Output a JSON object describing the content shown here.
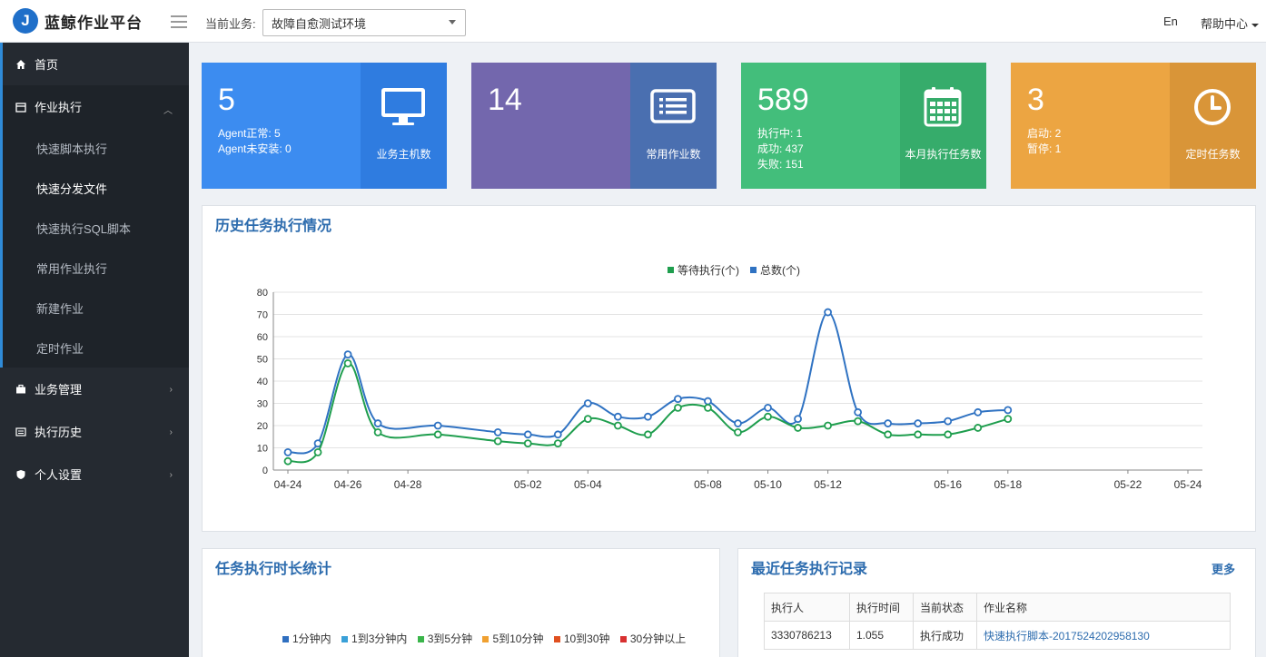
{
  "app": {
    "logo_letter": "J",
    "title": "蓝鲸作业平台"
  },
  "header": {
    "business_label": "当前业务:",
    "business_value": "故障自愈测试环境",
    "lang": "En",
    "help": "帮助中心"
  },
  "sidebar": {
    "home": "首页",
    "job_exec": "作业执行",
    "sub_items": [
      "快速脚本执行",
      "快速分发文件",
      "快速执行SQL脚本",
      "常用作业执行",
      "新建作业",
      "定时作业"
    ],
    "biz_manage": "业务管理",
    "exec_history": "执行历史",
    "personal": "个人设置"
  },
  "cards": [
    {
      "num": "5",
      "lines": [
        "Agent正常: 5",
        "Agent未安装: 0"
      ],
      "caption": "业务主机数",
      "color_left": "#3c8cf0",
      "color_right": "#2f7ce0",
      "icon": "monitor-icon"
    },
    {
      "num": "14",
      "lines": [],
      "caption": "常用作业数",
      "color_left": "#7367ad",
      "color_right": "#4a6fb0",
      "icon": "list-card-icon"
    },
    {
      "num": "589",
      "lines": [
        "执行中: 1",
        "成功: 437",
        "失败: 151"
      ],
      "caption": "本月执行任务数",
      "color_left": "#43be7b",
      "color_right": "#36ac6b",
      "icon": "calendar-icon"
    },
    {
      "num": "3",
      "lines": [
        "启动: 2",
        "暂停: 1"
      ],
      "caption": "定时任务数",
      "color_left": "#eca542",
      "color_right": "#d99538",
      "icon": "clock-icon"
    }
  ],
  "history_panel": {
    "title": "历史任务执行情况"
  },
  "duration_panel": {
    "title": "任务执行时长统计",
    "legend": [
      {
        "label": "1分钟内",
        "color": "#2f6fc0"
      },
      {
        "label": "1到3分钟内",
        "color": "#3aa0d8"
      },
      {
        "label": "3到5分钟",
        "color": "#3ab54a"
      },
      {
        "label": "5到10分钟",
        "color": "#f0a030"
      },
      {
        "label": "10到30钟",
        "color": "#e05020"
      },
      {
        "label": "30分钟以上",
        "color": "#d83030"
      }
    ]
  },
  "records_panel": {
    "title": "最近任务执行记录",
    "more": "更多",
    "headers": [
      "执行人",
      "执行时间",
      "当前状态",
      "作业名称"
    ],
    "rows": [
      [
        "3330786213",
        "1.055",
        "执行成功",
        "快速执行脚本-2017524202958130"
      ]
    ]
  },
  "chart_data": {
    "type": "line",
    "title": "",
    "xlabel": "",
    "ylabel": "",
    "ylim": [
      0,
      80
    ],
    "yticks": [
      0,
      10,
      20,
      30,
      40,
      50,
      60,
      70,
      80
    ],
    "x": [
      "04-24",
      "04-25",
      "04-26",
      "04-27",
      "04-28",
      "04-29",
      "04-30",
      "05-01",
      "05-02",
      "05-03",
      "05-04",
      "05-05",
      "05-06",
      "05-07",
      "05-08",
      "05-09",
      "05-10",
      "05-11",
      "05-12",
      "05-13",
      "05-14",
      "05-15",
      "05-16",
      "05-17",
      "05-18",
      "05-19",
      "05-20",
      "05-21",
      "05-22",
      "05-23",
      "05-24"
    ],
    "xtick_labels": [
      "04-24",
      "04-26",
      "04-28",
      "05-02",
      "05-04",
      "05-08",
      "05-10",
      "05-12",
      "05-16",
      "05-18",
      "05-22",
      "05-24"
    ],
    "point_x": [
      "04-24",
      "04-25",
      "04-26",
      "04-27",
      "04-28",
      "04-29",
      "05-01",
      "05-03",
      "05-04",
      "05-05",
      "05-06",
      "05-07",
      "05-08",
      "05-09",
      "05-10",
      "05-12",
      "05-13",
      "05-14",
      "05-15",
      "05-16",
      "05-17",
      "05-18",
      "05-19",
      "05-20",
      "05-21",
      "05-22",
      "05-23",
      "05-24"
    ],
    "legend_position": "top",
    "series": [
      {
        "name": "等待执行(个)",
        "color": "#1f9e4e",
        "values": [
          4,
          8,
          48,
          17,
          16,
          13,
          12,
          12,
          23,
          20,
          16,
          28,
          28,
          17,
          24,
          19,
          20,
          22,
          16,
          16,
          16,
          19,
          23
        ]
      },
      {
        "name": "总数(个)",
        "color": "#2f72c2",
        "values": [
          8,
          12,
          52,
          21,
          20,
          17,
          16,
          16,
          30,
          24,
          24,
          32,
          31,
          21,
          28,
          23,
          71,
          26,
          21,
          21,
          22,
          26,
          27
        ]
      }
    ],
    "point_dates": [
      "04-24",
      "04-25",
      "04-26",
      "04-27",
      "04-29",
      "05-01",
      "05-02",
      "05-03",
      "05-04",
      "05-05",
      "05-06",
      "05-07",
      "05-08",
      "05-09",
      "05-10",
      "05-11",
      "05-12",
      "05-13",
      "05-14",
      "05-15",
      "05-16",
      "05-17",
      "05-18"
    ]
  }
}
